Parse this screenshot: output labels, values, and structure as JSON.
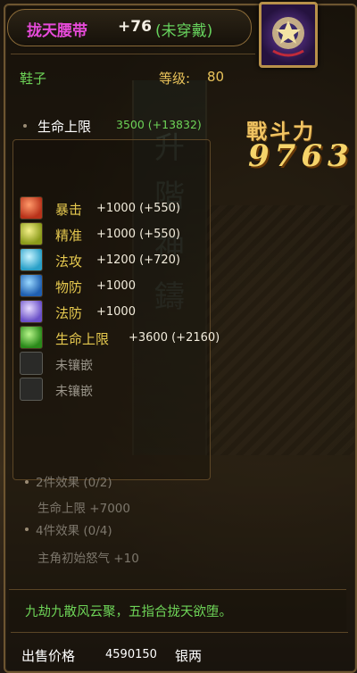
{
  "item": {
    "name": "拢天腰带",
    "enhance": "+76",
    "status": "(未穿戴)",
    "type": "鞋子",
    "level_label": "等级:",
    "level_value": "80"
  },
  "base_stat": {
    "label": "生命上限",
    "value": "3500 (+13832)"
  },
  "combat_power": {
    "label": "戰斗力",
    "value": "9763"
  },
  "background_text": [
    "升",
    "階",
    "神",
    "鑄"
  ],
  "gems": [
    {
      "label": "暴击",
      "value": "+1000 (+550)",
      "icon": "red-gem-icon",
      "color": "#d8532a"
    },
    {
      "label": "精准",
      "value": "+1000 (+550)",
      "icon": "yellow-gem-icon",
      "color": "#c8c22a"
    },
    {
      "label": "法攻",
      "value": "+1200 (+720)",
      "icon": "cyan-gem-icon",
      "color": "#4cc7e6"
    },
    {
      "label": "物防",
      "value": "+1000",
      "icon": "blue-gem-icon",
      "color": "#3c8fd6"
    },
    {
      "label": "法防",
      "value": "+1000",
      "icon": "purple-gem-icon",
      "color": "#9a7fe6"
    },
    {
      "label": "生命上限",
      "value": "+3600 (+2160)",
      "icon": "green-gem-icon",
      "color": "#4cc23a"
    }
  ],
  "empty_sockets": [
    "未镶嵌",
    "未镶嵌"
  ],
  "set_effects": {
    "two_piece": "2件效果 (0/2)",
    "two_piece_stat": "生命上限 +7000",
    "four_piece": "4件效果 (0/4)",
    "four_piece_stat": "主角初始怒气 +10"
  },
  "description": "九劫九散风云聚，五指合拢天欲堕。",
  "price": {
    "label": "出售价格",
    "value": "4590150",
    "unit": "银两"
  }
}
